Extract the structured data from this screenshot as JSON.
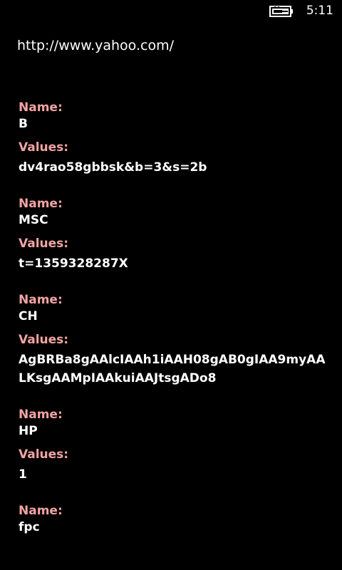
{
  "status": {
    "time": "5:11",
    "battery_icon": "battery-charging-icon"
  },
  "url": "http://www.yahoo.com/",
  "labels": {
    "name": "Name:",
    "values": "Values:"
  },
  "cookies": [
    {
      "name": "B",
      "values": "dv4rao58gbbsk&b=3&s=2b"
    },
    {
      "name": "MSC",
      "values": "t=1359328287X"
    },
    {
      "name": "CH",
      "values": "AgBRBa8gAAlcIAAh1iAAH08gAB0gIAA9myAALKsgAAMpIAAkuiAAJtsgADo8"
    },
    {
      "name": "HP",
      "values": "1"
    },
    {
      "name": "fpc",
      "values": ""
    }
  ],
  "colors": {
    "background": "#000000",
    "label": "#f2a3a3",
    "text": "#ffffff"
  }
}
